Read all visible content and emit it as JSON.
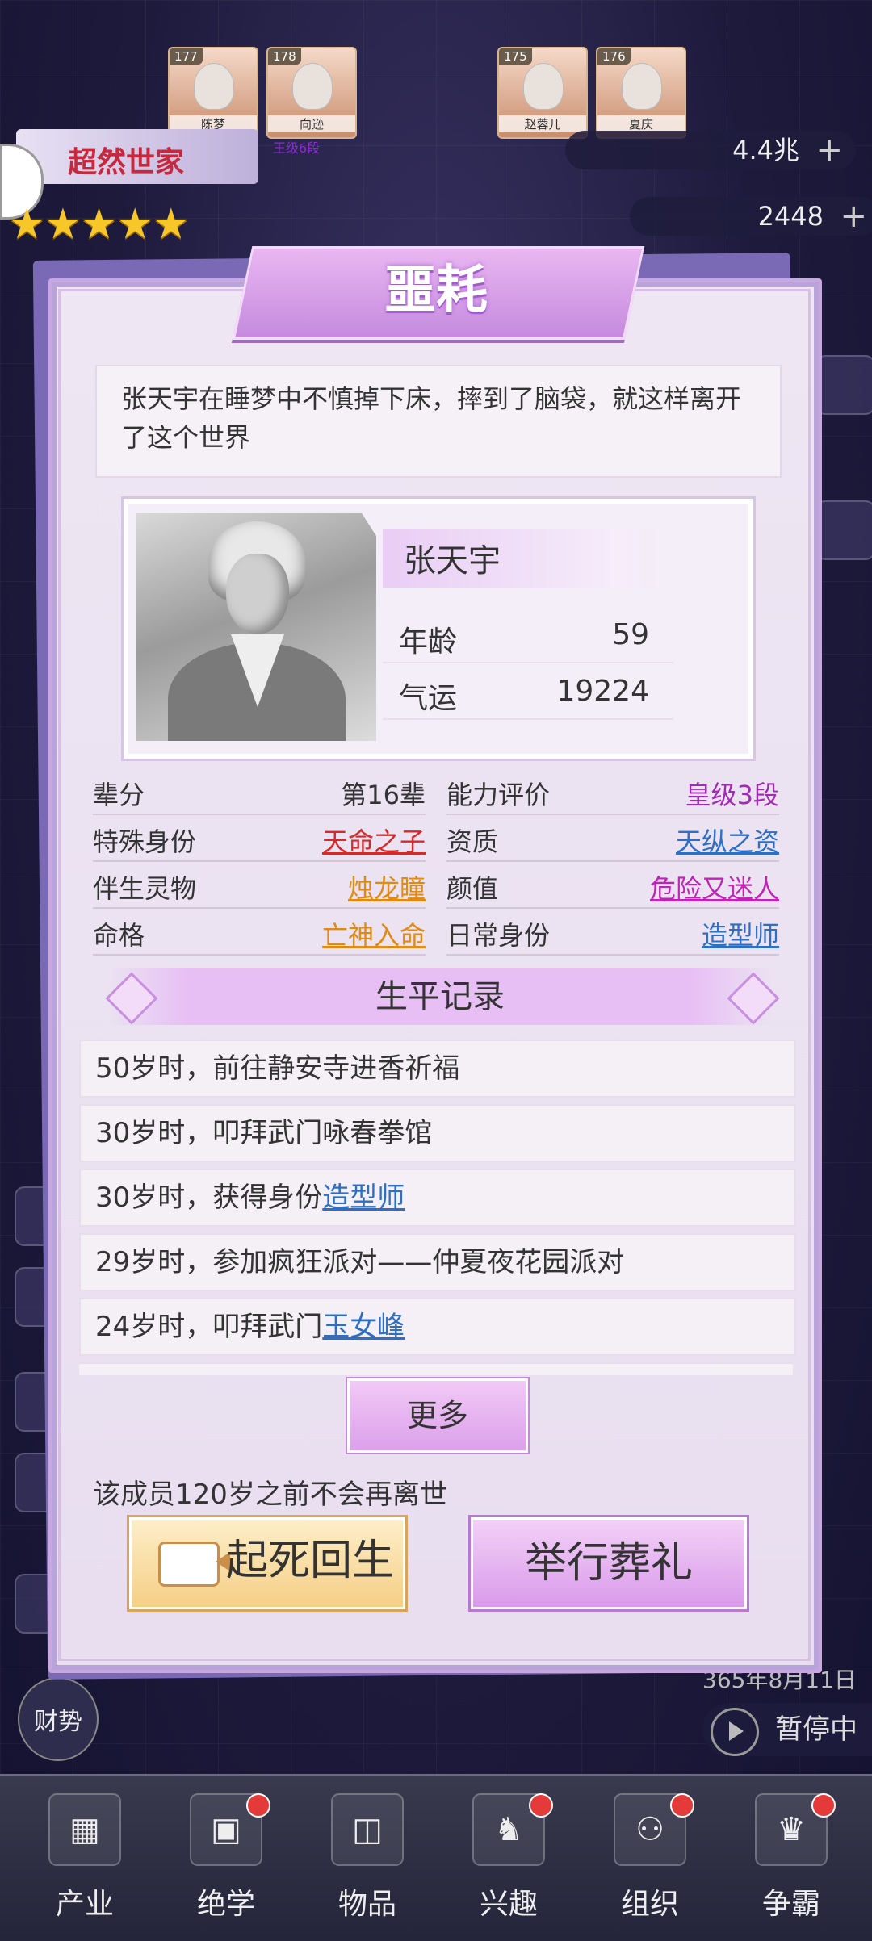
{
  "background": {
    "cards_top": [
      {
        "num": "177",
        "name": "陈梦"
      },
      {
        "num": "178",
        "name": "向逊"
      },
      {
        "num": "175",
        "name": "赵蓉儿"
      },
      {
        "num": "176",
        "name": "夏庆"
      }
    ],
    "card_tag": "王级6段",
    "family_title": "超然世家",
    "resources": [
      "4.4兆",
      "2448"
    ],
    "date_text": "365年8月11日",
    "pause_label": "暂停中",
    "caishi_label": "财势"
  },
  "dialog": {
    "title": "噩耗",
    "message": "张天宇在睡梦中不慎掉下床，摔到了脑袋，就这样离开了这个世界",
    "profile": {
      "name": "张天宇",
      "age_label": "年龄",
      "age": "59",
      "luck_label": "气运",
      "luck": "19224"
    },
    "attributes": {
      "generation_label": "辈分",
      "generation": "第16辈",
      "ability_label": "能力评价",
      "ability": "皇级3段",
      "special_label": "特殊身份",
      "special": "天命之子",
      "talent_label": "资质",
      "talent": "天纵之资",
      "spirit_label": "伴生灵物",
      "spirit": "烛龙瞳",
      "looks_label": "颜值",
      "looks": "危险又迷人",
      "fate_label": "命格",
      "fate": "亡神入命",
      "job_label": "日常身份",
      "job": "造型师"
    },
    "records_title": "生平记录",
    "records": [
      {
        "text": "50岁时，前往静安寺进香祈福",
        "link": ""
      },
      {
        "text": "30岁时，叩拜武门咏春拳馆",
        "link": ""
      },
      {
        "text": "30岁时，获得身份",
        "link": "造型师"
      },
      {
        "text": "29岁时，参加疯狂派对——仲夏夜花园派对",
        "link": ""
      },
      {
        "text": "24岁时，叩拜武门",
        "link": "玉女峰"
      }
    ],
    "more_label": "更多",
    "note": "该成员120岁之前不会再离世",
    "revive_label": "起死回生",
    "funeral_label": "举行葬礼"
  },
  "nav": [
    {
      "label": "产业",
      "icon": "building-icon",
      "badge": false
    },
    {
      "label": "绝学",
      "icon": "book-icon",
      "badge": true
    },
    {
      "label": "物品",
      "icon": "bag-icon",
      "badge": false
    },
    {
      "label": "兴趣",
      "icon": "chess-knight-icon",
      "badge": true
    },
    {
      "label": "组织",
      "icon": "org-chart-icon",
      "badge": true
    },
    {
      "label": "争霸",
      "icon": "trophy-icon",
      "badge": true
    }
  ],
  "colors": {
    "accent": "#c58ade",
    "red_link": "#d42a2a",
    "orange_link": "#e08a12",
    "blue_link": "#2d6fc7",
    "magenta_link": "#c023b5",
    "gold_button": "#f5cf86"
  }
}
